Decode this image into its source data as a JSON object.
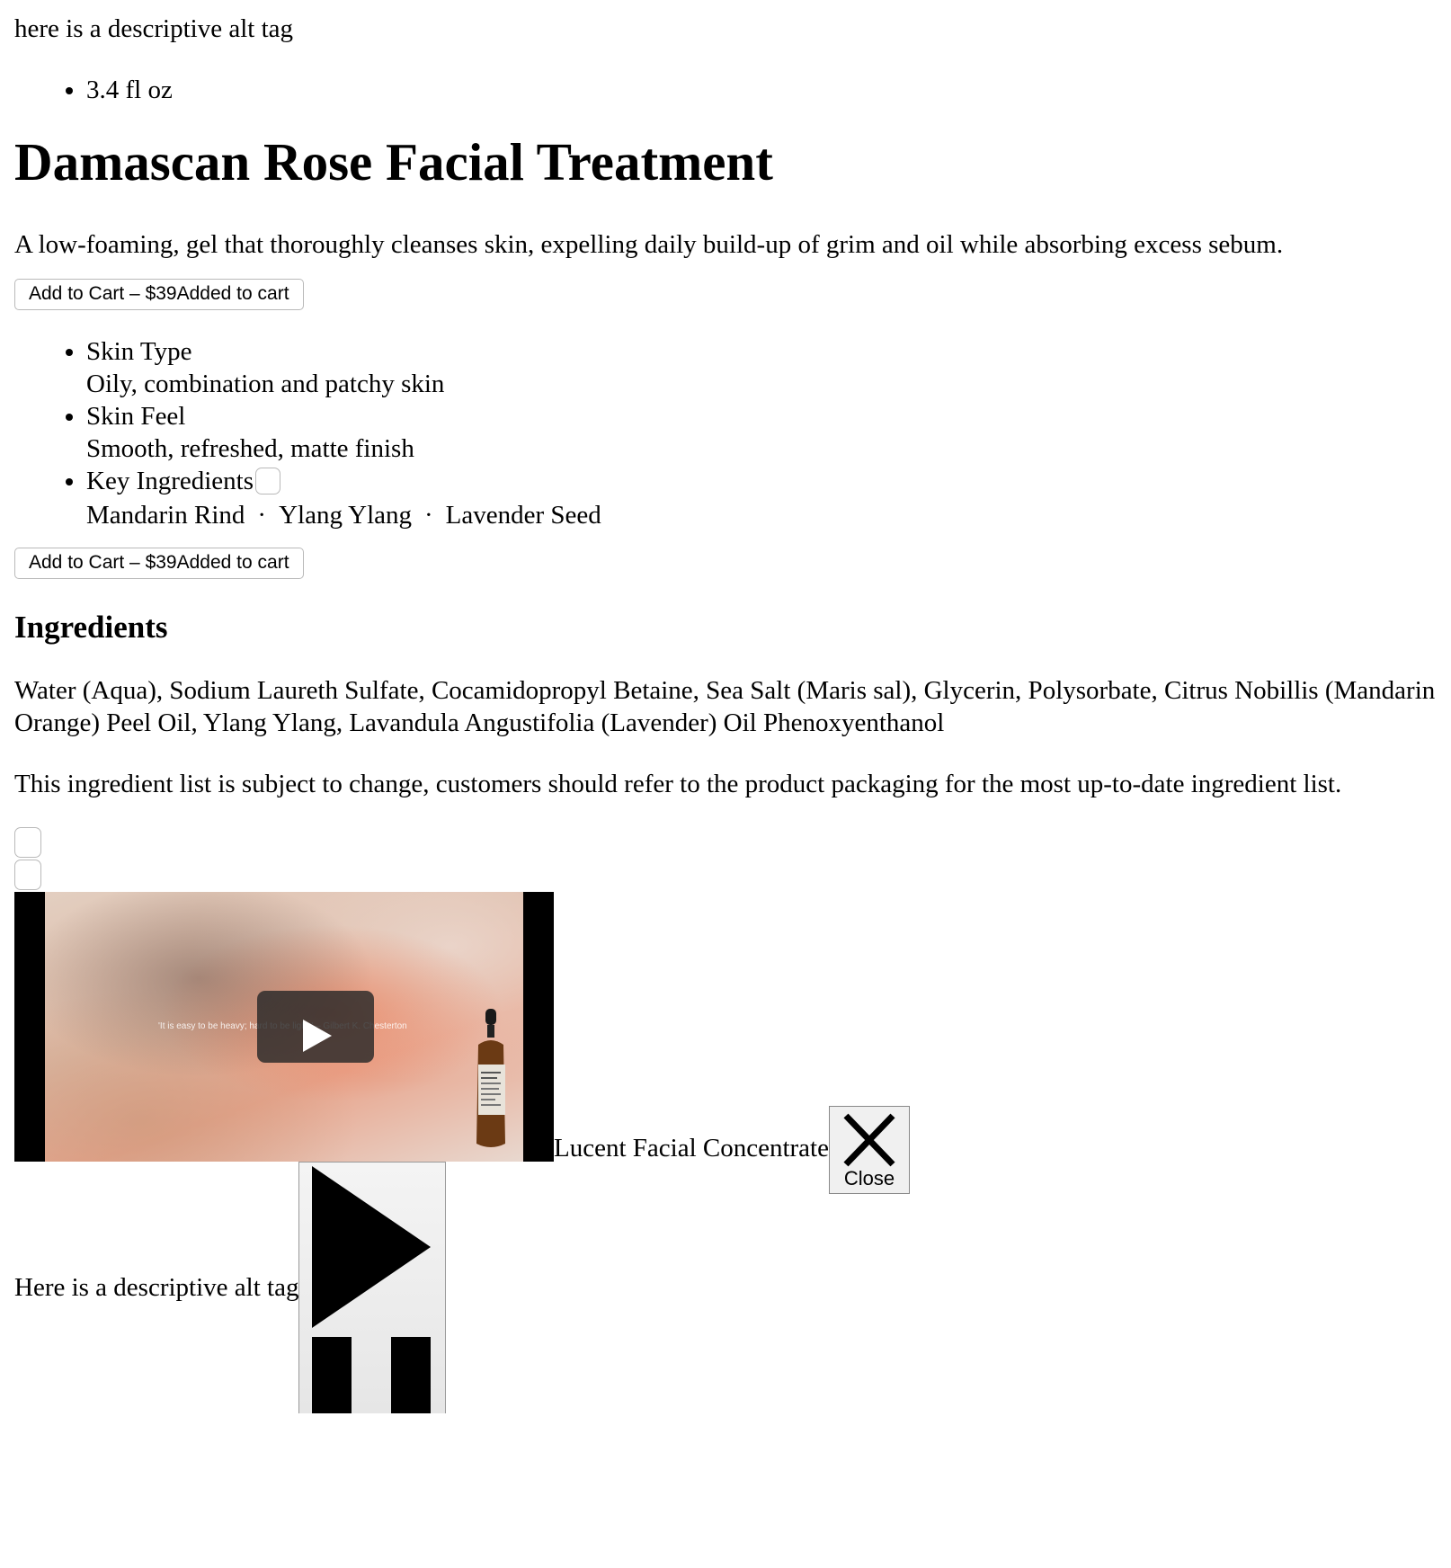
{
  "product": {
    "image_alt_top": "here is a descriptive alt tag",
    "size": "3.4 fl oz",
    "title": "Damascan Rose Facial Treatment",
    "description": "A low-foaming, gel that thoroughly cleanses skin, expelling daily build-up of grim and oil while absorbing excess sebum.",
    "cart_label": "Add to Cart – $39",
    "cart_added": "Added to cart"
  },
  "details": {
    "skin_type_label": "Skin Type",
    "skin_type_value": "Oily, combination and patchy skin",
    "skin_feel_label": "Skin Feel",
    "skin_feel_value": "Smooth, refreshed, matte finish",
    "key_ingredients_label": "Key Ingredients",
    "key_ingredients": [
      "Mandarin Rind",
      "Ylang Ylang",
      "Lavender Seed"
    ],
    "separator": "·"
  },
  "ingredients": {
    "heading": "Ingredients",
    "list": "Water (Aqua), Sodium Laureth Sulfate, Cocamidopropyl Betaine, Sea Salt (Maris sal), Glycerin, Polysorbate, Citrus Nobillis (Mandarin Orange) Peel Oil, Ylang Ylang, Lavandula Angustifolia (Lavender) Oil Phenoxyenthanol",
    "note": "This ingredient list is subject to change, customers should refer to the product packaging for the most up-to-date ingredient list."
  },
  "video": {
    "quote": "'It is easy to be heavy; hard to be light.' – Gilbert K. Chesterton",
    "product_name": "Lucent Facial Concentrate",
    "close_label": "Close"
  },
  "bottom": {
    "image_alt": "Here is a descriptive alt tag"
  },
  "icons": {
    "play": "play-icon",
    "close": "close-x-icon",
    "play_pause": "play-pause-icon"
  }
}
